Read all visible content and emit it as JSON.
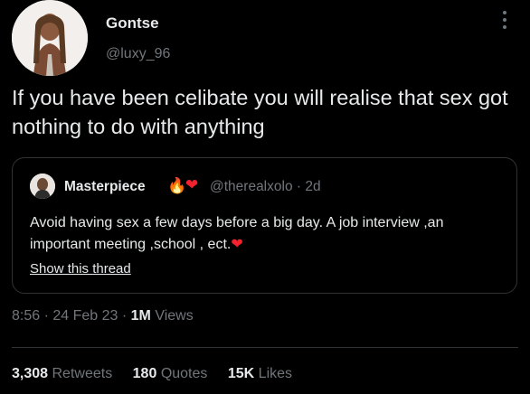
{
  "author": {
    "name": "Gontse",
    "handle": "@luxy_96",
    "avatar_icon": "profile-photo-icon"
  },
  "tweet": {
    "text": "If you have been celibate you will realise that sex got nothing to do with anything"
  },
  "quoted_tweet": {
    "name": "Masterpiece",
    "emoji_fire": "🔥",
    "emoji_heart": "❤",
    "handle": "@therealxolo · 2d",
    "text": "Avoid having sex a few days before a big day. A job interview ,an important meeting ,school , ect.",
    "text_heart": "❤",
    "show_thread": "Show this thread"
  },
  "meta": {
    "time": "8:56",
    "sep1": " · ",
    "date": "24 Feb 23",
    "sep2": " · ",
    "views": "1M",
    "views_label": "Views"
  },
  "stats": {
    "retweets": "3,308",
    "retweets_label": "Retweets",
    "quotes": "180",
    "quotes_label": "Quotes",
    "likes": "15K",
    "likes_label": "Likes"
  }
}
